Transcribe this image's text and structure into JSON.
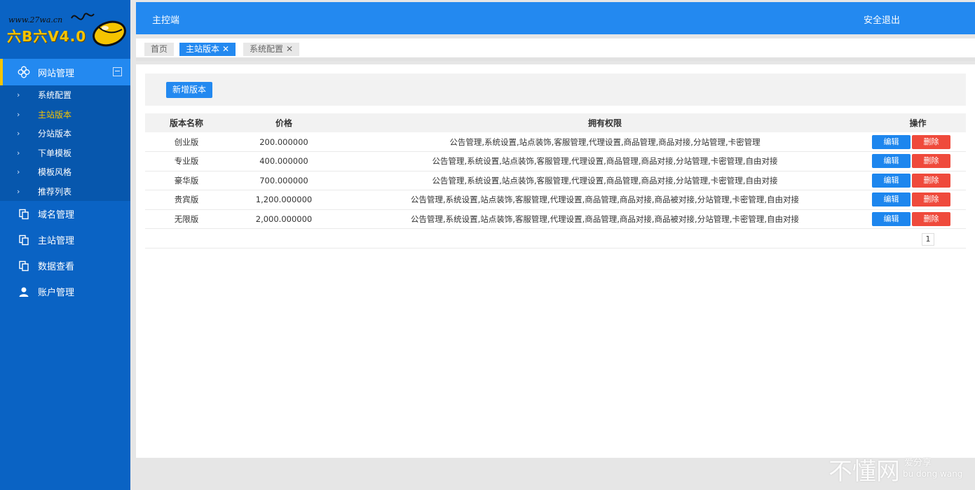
{
  "logo": {
    "url": "www.27wa.cn",
    "brand": "六B六V4.0"
  },
  "sidebar": {
    "group": {
      "label": "网站管理",
      "icon": "clover-icon",
      "collapse_symbol": "−",
      "items": [
        {
          "label": "系统配置"
        },
        {
          "label": "主站版本"
        },
        {
          "label": "分站版本"
        },
        {
          "label": "下单模板"
        },
        {
          "label": "模板风格"
        },
        {
          "label": "推荐列表"
        }
      ],
      "current_index": 1
    },
    "items": [
      {
        "label": "域名管理",
        "icon": "copy-icon"
      },
      {
        "label": "主站管理",
        "icon": "copy-icon"
      },
      {
        "label": "数据查看",
        "icon": "copy-icon"
      },
      {
        "label": "账户管理",
        "icon": "user-icon"
      }
    ]
  },
  "header": {
    "title": "主控端",
    "logout": "安全退出"
  },
  "tabs": [
    {
      "label": "首页",
      "closable": false
    },
    {
      "label": "主站版本",
      "closable": true,
      "active": true
    },
    {
      "label": "系统配置",
      "closable": true
    }
  ],
  "toolbar": {
    "add_label": "新增版本"
  },
  "table": {
    "headers": [
      "版本名称",
      "价格",
      "拥有权限",
      "操作"
    ],
    "rows": [
      {
        "name": "创业版",
        "price": "200.000000",
        "perms": "公告管理,系统设置,站点装饰,客服管理,代理设置,商品管理,商品对接,分站管理,卡密管理"
      },
      {
        "name": "专业版",
        "price": "400.000000",
        "perms": "公告管理,系统设置,站点装饰,客服管理,代理设置,商品管理,商品对接,分站管理,卡密管理,自由对接"
      },
      {
        "name": "豪华版",
        "price": "700.000000",
        "perms": "公告管理,系统设置,站点装饰,客服管理,代理设置,商品管理,商品对接,分站管理,卡密管理,自由对接"
      },
      {
        "name": "贵宾版",
        "price": "1,200.000000",
        "perms": "公告管理,系统设置,站点装饰,客服管理,代理设置,商品管理,商品对接,商品被对接,分站管理,卡密管理,自由对接"
      },
      {
        "name": "无限版",
        "price": "2,000.000000",
        "perms": "公告管理,系统设置,站点装饰,客服管理,代理设置,商品管理,商品对接,商品被对接,分站管理,卡密管理,自由对接"
      }
    ],
    "edit_label": "编辑",
    "delete_label": "删除"
  },
  "pagination": {
    "current": "1"
  },
  "watermark": {
    "big": "不懂网",
    "small1": "爱分享",
    "small2": "bu dong wang"
  },
  "colors": {
    "sidebar": "#0a63c4",
    "accent": "#2389f0",
    "highlight": "#f5c400",
    "danger": "#ef4a3c"
  }
}
